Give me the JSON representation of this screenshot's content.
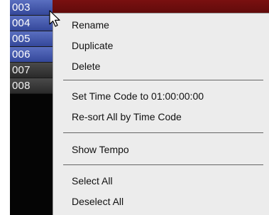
{
  "markers": [
    {
      "label": "003",
      "style": "blue"
    },
    {
      "label": "004",
      "style": "blue"
    },
    {
      "label": "005",
      "style": "blue"
    },
    {
      "label": "006",
      "style": "blue"
    },
    {
      "label": "007",
      "style": "gray"
    },
    {
      "label": "008",
      "style": "gray"
    }
  ],
  "context_menu": {
    "rename": "Rename",
    "duplicate": "Duplicate",
    "delete": "Delete",
    "set_time_code": "Set Time Code to 01:00:00:00",
    "resort": "Re-sort All by Time Code",
    "show_tempo": "Show Tempo",
    "select_all": "Select All",
    "deselect_all": "Deselect All"
  },
  "colors": {
    "marker_blue": "#4257ad",
    "marker_gray": "#3a3a3a",
    "header_red": "#6e0d0d",
    "menu_bg": "#ececec"
  },
  "icons": {
    "cursor": "arrow-pointer-icon"
  }
}
